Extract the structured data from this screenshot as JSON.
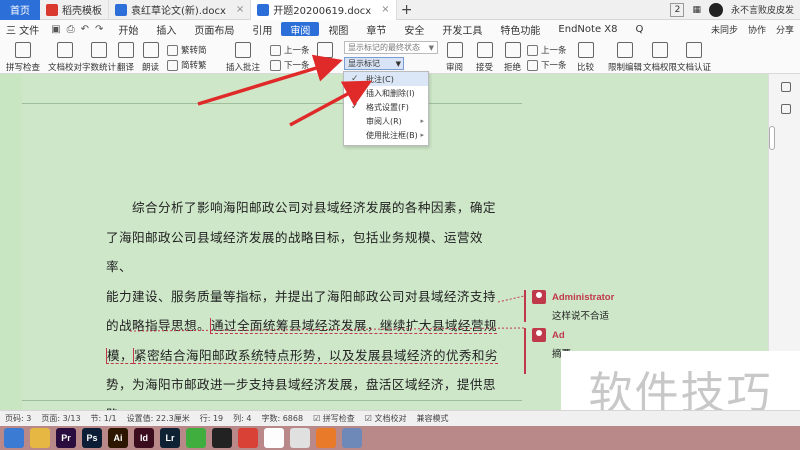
{
  "titlebar": {
    "home_tab": "首页",
    "tabs": [
      {
        "label": "稻壳模板",
        "color": "#d9392e",
        "active": false
      },
      {
        "label": "袁红草论文(新).docx",
        "color": "#2d6fd8",
        "active": false
      },
      {
        "label": "开题20200619.docx",
        "color": "#2d6fd8",
        "active": true
      }
    ],
    "add_tab": "+",
    "window_count": "2",
    "user_name": "永不言败皮皮发"
  },
  "menubar": {
    "file": "三 文件",
    "items": [
      "开始",
      "插入",
      "页面布局",
      "引用",
      "审阅",
      "视图",
      "章节",
      "安全",
      "开发工具",
      "特色功能",
      "EndNote X8"
    ],
    "active_item": "审阅",
    "search": "Q",
    "right": [
      "未同步",
      "协作",
      "分享"
    ]
  },
  "ribbon": {
    "spell_check": "拼写检查",
    "doc_proof": "文档校对",
    "word_count": "字数统计",
    "translate": "翻译",
    "read_aloud": "朗读",
    "trad_simp": "繁转简",
    "simp_trad": "简转繁",
    "insert_comment": "插入批注",
    "prev_comment": "上一条",
    "next_comment": "下一条",
    "revise": "修订",
    "final_state": "显示标记的最终状态",
    "show_marks": "显示标记",
    "reviewer": "审阅",
    "accept": "接受",
    "reject": "拒绝",
    "prev_change": "上一条",
    "next_change": "下一条",
    "compare": "比较",
    "restrict_edit": "限制编辑",
    "doc_permission": "文档权限",
    "doc_auth": "文档认证"
  },
  "dropdown": {
    "items": [
      {
        "label": "批注(C)",
        "checked": true,
        "submenu": false,
        "highlighted": true
      },
      {
        "label": "插入和删除(I)",
        "checked": true,
        "submenu": false,
        "highlighted": false
      },
      {
        "label": "格式设置(F)",
        "checked": true,
        "submenu": false,
        "highlighted": false
      },
      {
        "label": "审阅人(R)",
        "checked": false,
        "submenu": true,
        "highlighted": false
      },
      {
        "label": "使用批注框(B)",
        "checked": false,
        "submenu": true,
        "highlighted": false
      }
    ]
  },
  "document": {
    "line1": "综合分析了影响海阳邮政公司对县域经济发展的各种因素，确定",
    "line2": "了海阳邮政公司县域经济发展的战略目标，包括业务规模、运营效率、",
    "line3": "能力建设、服务质量等指标，并提出了海阳邮政公司对县域经济支持",
    "line4a": "的战略指导思想。",
    "line4b": "通过全面统筹县域经济发展，继续扩大县域经营规",
    "line5a": "模，",
    "line5b": "紧密结合海阳邮政系统特点形势，以及发展县域经济的优秀和劣",
    "line6": "势，为海阳市邮政进一步支持县域经济发展，盘活区域经济，提供思",
    "line7": "路。"
  },
  "comments": [
    {
      "author": "Administrator",
      "text": "这样说不合适"
    },
    {
      "author": "Ad",
      "text": "摘要"
    }
  ],
  "watermark": "软件技巧",
  "statusbar": {
    "page": "页码: 3",
    "pages": "页面: 3/13",
    "section": "节: 1/1",
    "setting": "设置值: 22.3厘米",
    "row": "行: 19",
    "col": "列: 4",
    "words": "字数: 6868",
    "spell": "拼写检查",
    "proof": "文档校对",
    "compat": "兼容模式"
  },
  "taskbar": {
    "apps": [
      {
        "name": "browser-icon",
        "label": "",
        "color": "#3b7bd4"
      },
      {
        "name": "folder-icon",
        "label": "",
        "color": "#e7b744"
      },
      {
        "name": "premiere-icon",
        "label": "Pr",
        "color": "#2a0d3e"
      },
      {
        "name": "photoshop-icon",
        "label": "Ps",
        "color": "#0b1e36"
      },
      {
        "name": "illustrator-icon",
        "label": "Ai",
        "color": "#2c1600"
      },
      {
        "name": "indesign-icon",
        "label": "Id",
        "color": "#3b0b1e"
      },
      {
        "name": "lightroom-icon",
        "label": "Lr",
        "color": "#0e2233"
      },
      {
        "name": "wechat-icon",
        "label": "",
        "color": "#3fae3f"
      },
      {
        "name": "video-icon",
        "label": "",
        "color": "#222222"
      },
      {
        "name": "wps-icon",
        "label": "",
        "color": "#d94036"
      },
      {
        "name": "qq-icon",
        "label": "",
        "color": "#fdfdfd"
      },
      {
        "name": "chrome-icon",
        "label": "",
        "color": "#e0e0e0"
      },
      {
        "name": "firefox-icon",
        "label": "",
        "color": "#e87a2a"
      },
      {
        "name": "app-icon",
        "label": "",
        "color": "#6e89b8"
      }
    ]
  }
}
